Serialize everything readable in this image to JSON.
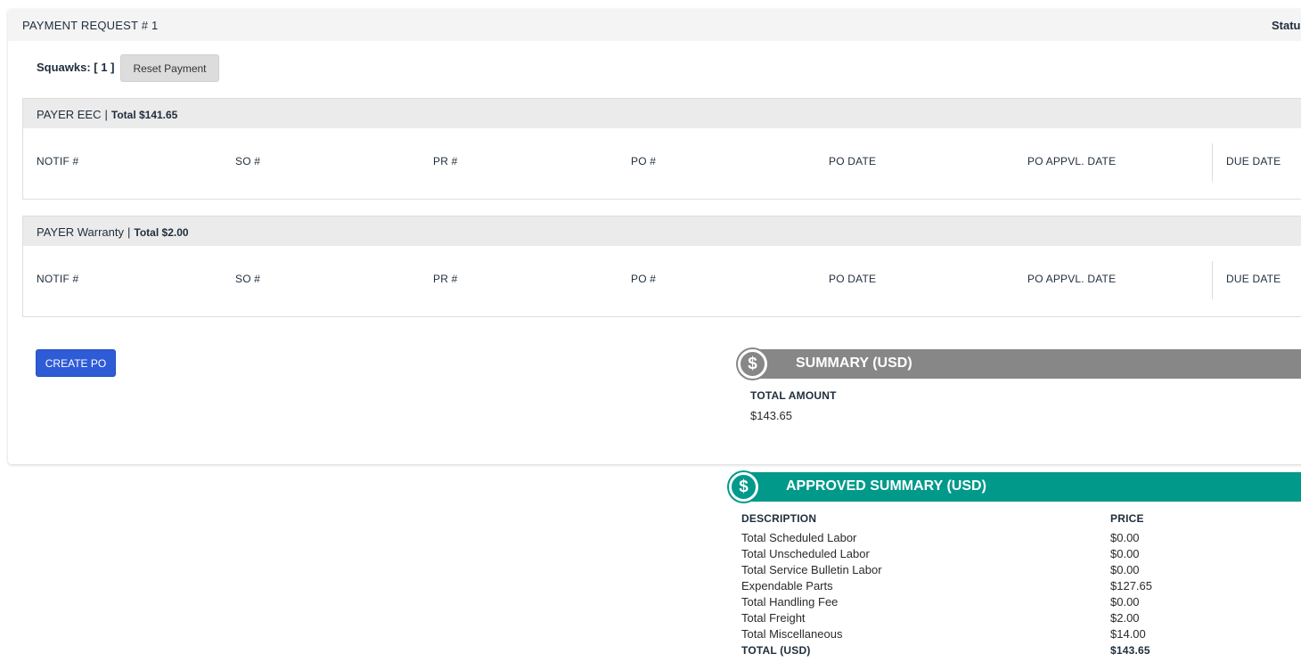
{
  "card": {
    "title": "PAYMENT REQUEST # 1",
    "status_label": "Statu"
  },
  "squawks": {
    "label": "Squawks: [ 1 ]",
    "reset_button": "Reset Payment"
  },
  "payers": [
    {
      "name": "PAYER EEC",
      "separator": "|",
      "total": "Total $141.65"
    },
    {
      "name": "PAYER Warranty",
      "separator": "|",
      "total": "Total $2.00"
    }
  ],
  "columns": [
    "NOTIF #",
    "SO #",
    "PR #",
    "PO #",
    "PO DATE",
    "PO APPVL. DATE",
    "DUE DATE"
  ],
  "create_po_button": "CREATE PO",
  "summary": {
    "icon": "dollar-icon",
    "title": "SUMMARY (USD)",
    "color": "#878787",
    "total_label": "TOTAL AMOUNT",
    "total_value": "$143.65"
  },
  "approved_summary": {
    "icon": "dollar-icon",
    "title": "APPROVED SUMMARY (USD)",
    "color": "#00998a",
    "headers": {
      "description": "DESCRIPTION",
      "price": "PRICE"
    },
    "rows": [
      {
        "description": "Total Scheduled Labor",
        "price": "$0.00"
      },
      {
        "description": "Total Unscheduled Labor",
        "price": "$0.00"
      },
      {
        "description": "Total Service Bulletin Labor",
        "price": "$0.00"
      },
      {
        "description": "Expendable Parts",
        "price": "$127.65"
      },
      {
        "description": "Total Handling Fee",
        "price": "$0.00"
      },
      {
        "description": "Total Freight",
        "price": "$2.00"
      },
      {
        "description": "Total Miscellaneous",
        "price": "$14.00"
      }
    ],
    "total": {
      "description": "TOTAL (USD)",
      "price": "$143.65"
    }
  }
}
